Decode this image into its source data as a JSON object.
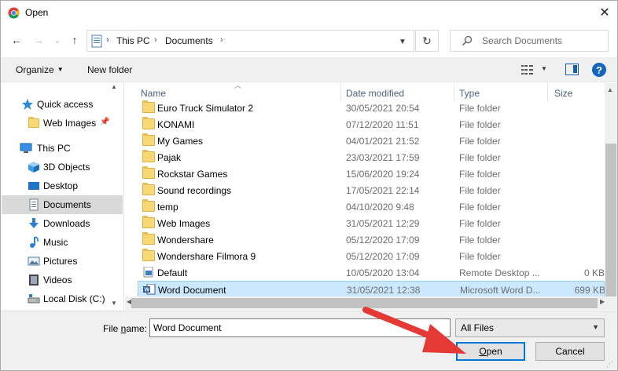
{
  "window": {
    "title": "Open",
    "close": "✕"
  },
  "nav": {
    "back": "←",
    "forward": "→",
    "recent": "⌄",
    "up": "↑",
    "breadcrumb": [
      "This PC",
      "Documents"
    ],
    "separator": "›",
    "refresh": "↻",
    "search_placeholder": "Search Documents"
  },
  "toolbar": {
    "organize": "Organize",
    "new_folder": "New folder"
  },
  "sidebar": {
    "items": [
      {
        "label": "Quick access",
        "icon": "star-icon",
        "pinned": false
      },
      {
        "label": "Web Images",
        "icon": "folder-icon",
        "pinned": true
      },
      {
        "label": "This PC",
        "icon": "computer-icon",
        "pinned": false
      },
      {
        "label": "3D Objects",
        "icon": "cube-icon",
        "pinned": false
      },
      {
        "label": "Desktop",
        "icon": "desktop-icon",
        "pinned": false
      },
      {
        "label": "Documents",
        "icon": "documents-icon",
        "pinned": false,
        "selected": true
      },
      {
        "label": "Downloads",
        "icon": "download-icon",
        "pinned": false
      },
      {
        "label": "Music",
        "icon": "music-icon",
        "pinned": false
      },
      {
        "label": "Pictures",
        "icon": "pictures-icon",
        "pinned": false
      },
      {
        "label": "Videos",
        "icon": "video-icon",
        "pinned": false
      },
      {
        "label": "Local Disk (C:)",
        "icon": "disk-icon",
        "pinned": false
      }
    ]
  },
  "columns": {
    "name": "Name",
    "date": "Date modified",
    "type": "Type",
    "size": "Size"
  },
  "files": [
    {
      "name": "Euro Truck Simulator 2",
      "date": "30/05/2021 20:54",
      "type": "File folder",
      "size": "",
      "icon": "folder-icon"
    },
    {
      "name": "KONAMI",
      "date": "07/12/2020 11:51",
      "type": "File folder",
      "size": "",
      "icon": "folder-icon"
    },
    {
      "name": "My Games",
      "date": "04/01/2021 21:52",
      "type": "File folder",
      "size": "",
      "icon": "folder-icon"
    },
    {
      "name": "Pajak",
      "date": "23/03/2021 17:59",
      "type": "File folder",
      "size": "",
      "icon": "folder-icon"
    },
    {
      "name": "Rockstar Games",
      "date": "15/06/2020 19:24",
      "type": "File folder",
      "size": "",
      "icon": "folder-icon"
    },
    {
      "name": "Sound recordings",
      "date": "17/05/2021 22:14",
      "type": "File folder",
      "size": "",
      "icon": "folder-icon"
    },
    {
      "name": "temp",
      "date": "04/10/2020 9:48",
      "type": "File folder",
      "size": "",
      "icon": "folder-icon"
    },
    {
      "name": "Web Images",
      "date": "31/05/2021 12:29",
      "type": "File folder",
      "size": "",
      "icon": "folder-icon"
    },
    {
      "name": "Wondershare",
      "date": "05/12/2020 17:09",
      "type": "File folder",
      "size": "",
      "icon": "folder-icon"
    },
    {
      "name": "Wondershare Filmora 9",
      "date": "05/12/2020 17:09",
      "type": "File folder",
      "size": "",
      "icon": "folder-icon"
    },
    {
      "name": "Default",
      "date": "10/05/2020 13:04",
      "type": "Remote Desktop ...",
      "size": "0 KB",
      "icon": "rdp-file-icon"
    },
    {
      "name": "Word Document",
      "date": "31/05/2021 12:38",
      "type": "Microsoft Word D...",
      "size": "699 KB",
      "icon": "word-doc-icon",
      "selected": true
    }
  ],
  "bottom": {
    "file_name_label_pre": "File ",
    "file_name_label_u": "n",
    "file_name_label_post": "ame:",
    "file_name_value": "Word Document",
    "filter": "All Files",
    "open_u": "O",
    "open_rest": "pen",
    "cancel": "Cancel"
  },
  "colors": {
    "accent": "#0078d7",
    "selection": "#cce8ff",
    "arrow": "#e53935"
  }
}
